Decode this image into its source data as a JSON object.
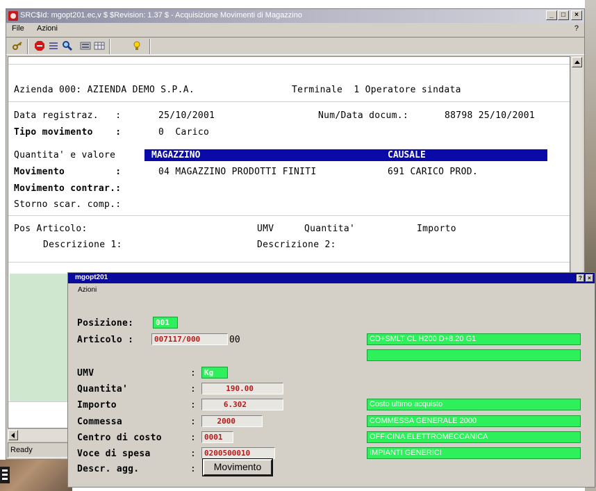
{
  "window": {
    "title": "SRC$Id: mgopt201.ec,v $ $Revision: 1.37 $ - Acquisizione Movimenti di Magazzino",
    "minimize": "_",
    "maximize": "□",
    "close": "×"
  },
  "menu": {
    "file": "File",
    "azioni": "Azioni",
    "help": "?"
  },
  "toolbar": {
    "icons": [
      "key-icon",
      "stop-sign-icon",
      "list-icon",
      "search-icon",
      "calculator-icon",
      "table-icon",
      "lightbulb-icon"
    ]
  },
  "terminal": {
    "header": {
      "azienda": "Azienda 000: AZIENDA DEMO S.P.A.",
      "terminale": "Terminale  1 Operatore sindata"
    },
    "data_registraz": {
      "label": "Data registraz.   :",
      "value": "25/10/2001"
    },
    "num_data_docum": {
      "label": "Num/Data docum.:",
      "value": "88798 25/10/2001"
    },
    "tipo_movimento": {
      "label": "Tipo movimento    :",
      "value": "0  Carico"
    },
    "quantita_valore": {
      "label": "Quantita' e valore"
    },
    "highlight": {
      "magazzino": "MAGAZZINO",
      "causale": "CAUSALE"
    },
    "movimento": {
      "label": "Movimento         :",
      "magazzino": "04 MAGAZZINO PRODOTTI FINITI",
      "causale": "691 CARICO PROD."
    },
    "movimento_contrar": {
      "label": "Movimento contrar.:"
    },
    "storno": {
      "label": "Storno scar. comp.:"
    },
    "columns": {
      "pos_articolo": "Pos Articolo:",
      "umv": "UMV",
      "quantita": "Quantita'",
      "importo": "Importo"
    },
    "descr": {
      "descrizione1": "Descrizione 1:",
      "descrizione2": "Descrizione 2:"
    }
  },
  "status": {
    "text": "Ready"
  },
  "dialog": {
    "title": "mgopt201",
    "menu": "Azioni",
    "btn_help": "?",
    "btn_close": "×",
    "fields": {
      "posizione": {
        "label": "Posizione:",
        "value": "001"
      },
      "articolo": {
        "label": "Articolo :",
        "value": "007117/000",
        "suffix": "00",
        "desc": "CD+SMLT CL H200 D+8.20  G1"
      },
      "umv": {
        "label": "UMV",
        "value": "Kg"
      },
      "quantita": {
        "label": "Quantita'",
        "value": "190.00"
      },
      "importo": {
        "label": "Importo",
        "value": "6.302",
        "desc": "Costo ultimo acquisto"
      },
      "commessa": {
        "label": "Commessa",
        "value": "2000",
        "desc": "COMMESSA GENERALE 2000"
      },
      "centro_costo": {
        "label": "Centro di costo",
        "value": "0001",
        "desc": "OFFICINA ELETTROMECCANICA"
      },
      "voce_spesa": {
        "label": "Voce di spesa",
        "value": "0200500010",
        "desc": "IMPIANTI GENERICI"
      },
      "descr_agg": {
        "label": "Descr. agg."
      }
    },
    "colon": ":",
    "button_movimento": "Movimento"
  }
}
